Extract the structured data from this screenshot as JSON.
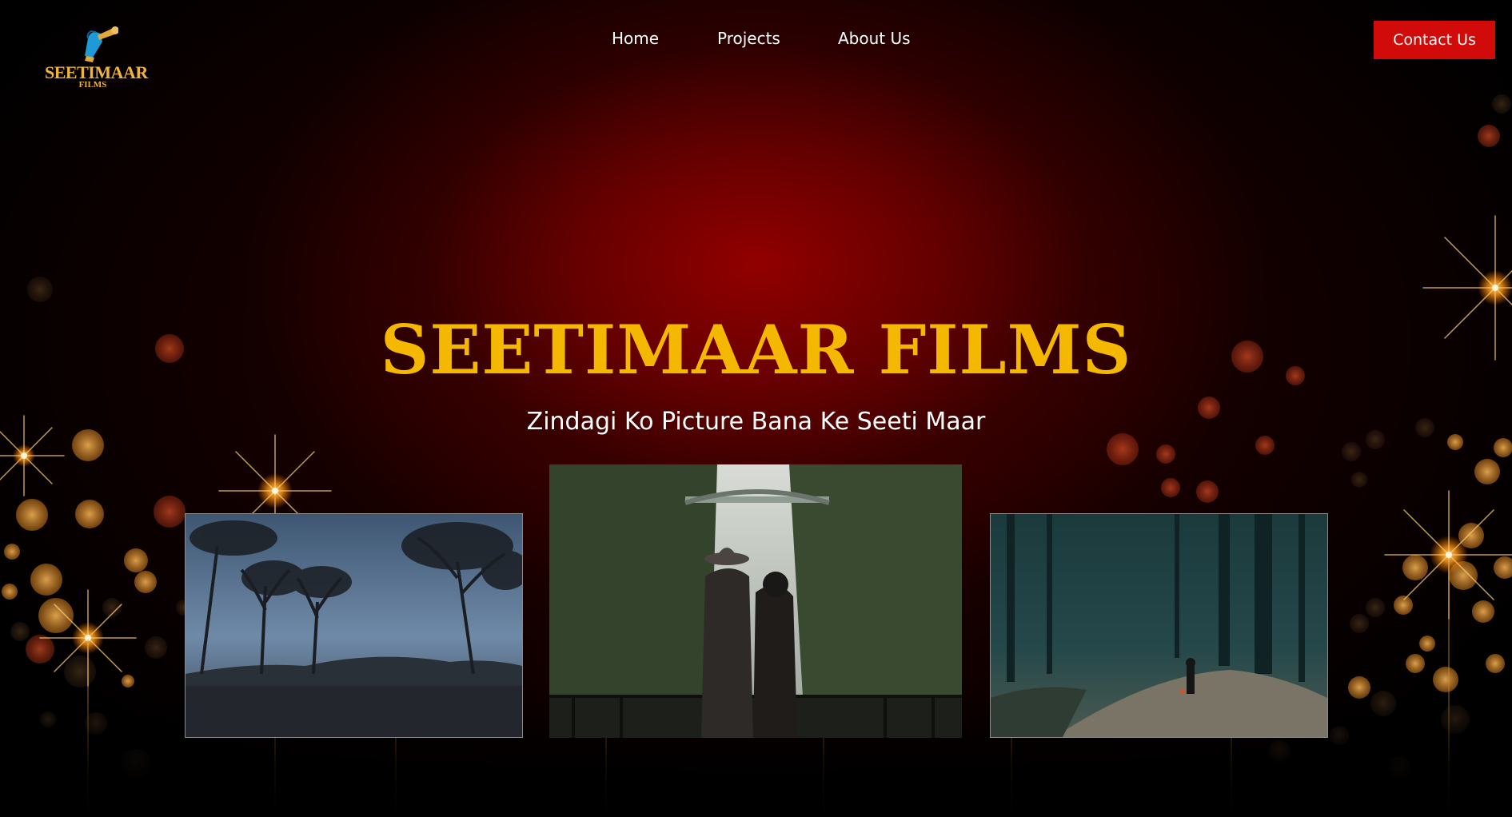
{
  "brand": {
    "logo_text": "SEETIMAAR",
    "logo_subtext": "FILMS",
    "accent_color": "#f5b800",
    "button_color": "#d10a0a",
    "background_color": "#8b0000"
  },
  "nav": {
    "items": [
      {
        "label": "Home"
      },
      {
        "label": "Projects"
      },
      {
        "label": "About Us"
      }
    ],
    "contact_label": "Contact Us"
  },
  "hero": {
    "title": "SEETIMAAR FILMS",
    "subtitle": "Zindagi Ko Picture Bana Ke Seeti Maar"
  },
  "gallery": {
    "images": [
      {
        "name": "trees-silhouette-photo",
        "icon": "landscape-photo"
      },
      {
        "name": "couple-waterfall-photo",
        "icon": "landscape-photo"
      },
      {
        "name": "forest-path-photo",
        "icon": "landscape-photo"
      }
    ]
  }
}
